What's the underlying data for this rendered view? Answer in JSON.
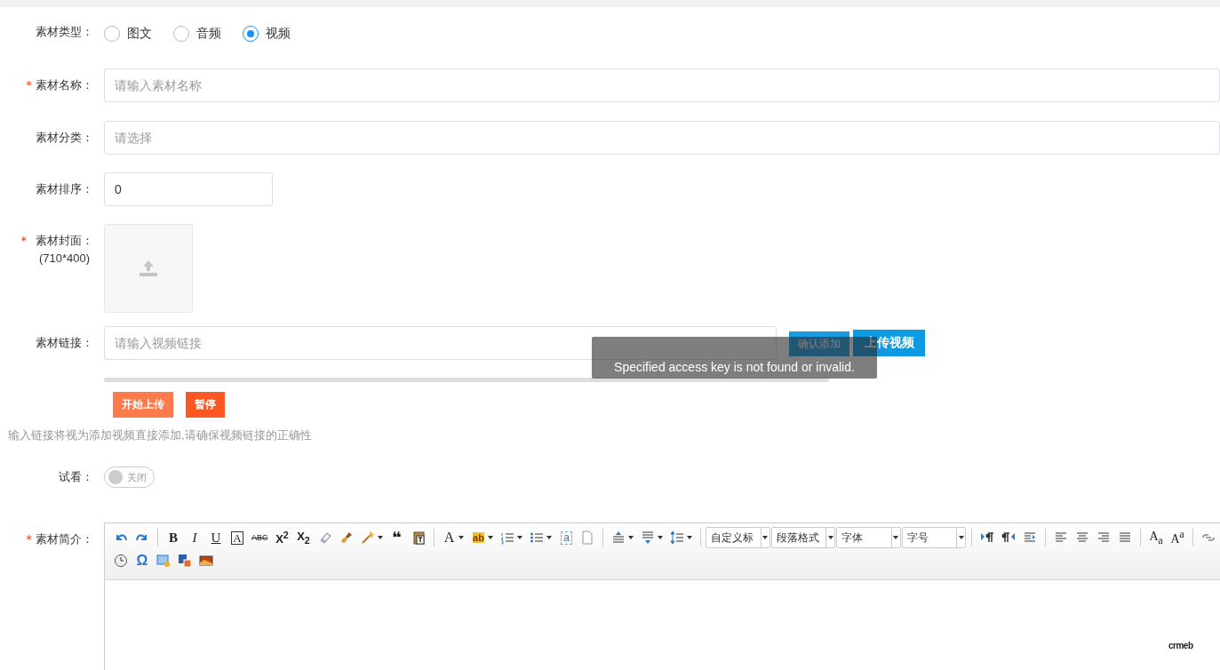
{
  "fields": [
    {
      "kind": "radio",
      "label": "素材类型：",
      "options": [
        {
          "label": "图文",
          "selected": false
        },
        {
          "label": "音频",
          "selected": false
        },
        {
          "label": "视频",
          "selected": true
        }
      ]
    },
    {
      "kind": "text",
      "label": "素材名称：",
      "required_mark": "*",
      "placeholder": "请输入素材名称"
    },
    {
      "kind": "select",
      "label": "素材分类：",
      "placeholder": "请选择"
    },
    {
      "kind": "short",
      "label": "素材排序：",
      "value": "0"
    },
    {
      "kind": "upload",
      "label": "素材封面：",
      "sublabel": "(710*400)",
      "required_mark": "*"
    },
    {
      "kind": "link",
      "label": "素材链接：",
      "placeholder": "请输入视频链接",
      "buttons": [
        "确认添加",
        "上传视频"
      ],
      "progress": {
        "level": 0
      },
      "actions": [
        "开始上传",
        "暂停"
      ]
    },
    {
      "kind": "hint",
      "text": "输入链接将视为添加视频直接添加,请确保视频链接的正确性"
    },
    {
      "kind": "switch",
      "label": "试看：",
      "on": false,
      "text": "关闭"
    },
    {
      "kind": "editor",
      "label": "素材简介：",
      "required_mark": "*",
      "toolbar": [
        [
          {
            "kind": "undo"
          },
          {
            "kind": "redo"
          },
          {
            "kind": "separator"
          },
          {
            "kind": "bold",
            "glyph": "B"
          },
          {
            "kind": "italic",
            "glyph": "I"
          },
          {
            "kind": "underline",
            "glyph": "U"
          },
          {
            "kind": "fontborder",
            "glyph": "A"
          },
          {
            "kind": "strikethrough",
            "glyph": "ABC"
          },
          {
            "kind": "superscript",
            "glyph": "X$^{2}$"
          },
          {
            "kind": "subscript",
            "glyph": "X$_{2}$"
          },
          {
            "kind": "eraser"
          },
          {
            "kind": "brush"
          },
          {
            "kind": "wand",
            "dropdown": true
          },
          {
            "kind": "quote",
            "glyph": "❝"
          },
          {
            "kind": "paste"
          },
          {
            "kind": "separator"
          },
          {
            "kind": "fontcolor",
            "glyph": "A",
            "dropdown": true
          },
          {
            "kind": "highlight",
            "glyph": "ab",
            "dropdown": true
          },
          {
            "kind": "orderedlist",
            "dropdown": true
          },
          {
            "kind": "unorderedlist",
            "dropdown": true
          },
          {
            "kind": "anchor",
            "glyph": "a"
          },
          {
            "kind": "page"
          },
          {
            "kind": "separator"
          },
          {
            "kind": "spacingtop",
            "dropdown": true
          },
          {
            "kind": "spacingbottom",
            "dropdown": true
          },
          {
            "kind": "lineheight",
            "dropdown": true
          },
          {
            "kind": "separator"
          },
          {
            "kind": "combo",
            "text": "自定义标"
          },
          {
            "kind": "combo",
            "text": "段落格式"
          },
          {
            "kind": "combo",
            "text": "字体"
          },
          {
            "kind": "combo",
            "text": "字号"
          },
          {
            "kind": "separator"
          },
          {
            "kind": "ltr"
          },
          {
            "kind": "rtl"
          },
          {
            "kind": "indent"
          },
          {
            "kind": "separator"
          },
          {
            "kind": "alignleft"
          },
          {
            "kind": "aligncenter"
          },
          {
            "kind": "alignright"
          },
          {
            "kind": "justify"
          },
          {
            "kind": "separator"
          },
          {
            "kind": "case",
            "glyph": "A$_{a}$"
          },
          {
            "kind": "case",
            "glyph": "A$^{a}$"
          },
          {
            "kind": "separator"
          },
          {
            "kind": "link"
          }
        ],
        [
          {
            "kind": "clock"
          },
          {
            "kind": "omega",
            "glyph": "Ω"
          },
          {
            "kind": "image"
          },
          {
            "kind": "wordimage"
          },
          {
            "kind": "picture"
          }
        ]
      ],
      "logo": "crmeb"
    }
  ],
  "toast": {
    "message": "Specified access key is not found or invalid."
  }
}
